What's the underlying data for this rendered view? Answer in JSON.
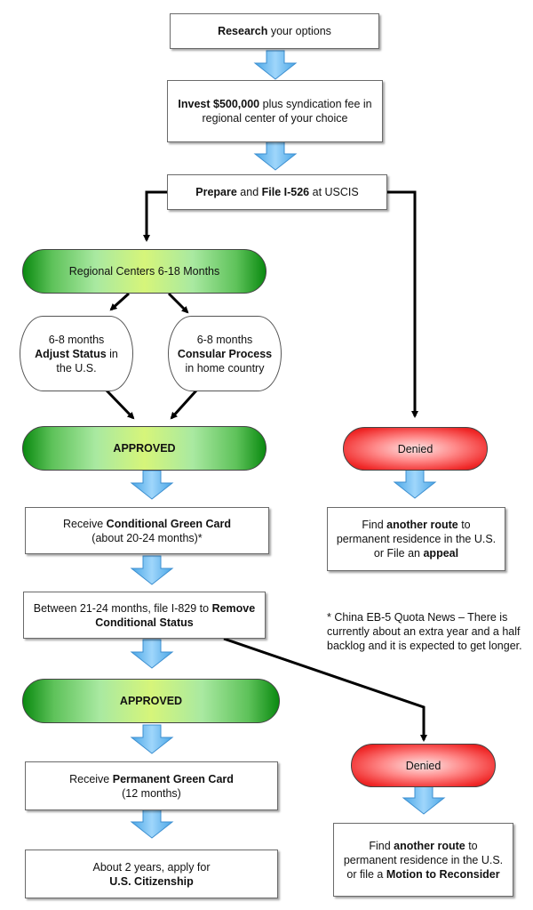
{
  "flowchart": {
    "research": {
      "bold": "Research",
      "rest": " your options"
    },
    "invest": {
      "bold": "Invest $500,000",
      "rest": " plus syndication fee in regional center of your choice"
    },
    "prepare": {
      "b1": "Prepare",
      "t1": " and ",
      "b2": "File I-526",
      "t2": " at USCIS"
    },
    "regional_centers": "Regional Centers 6-18 Months",
    "adjust": {
      "t1": "6-8 months",
      "b1": "Adjust Status",
      "t2": " in the U.S."
    },
    "consular": {
      "t1": "6-8 months",
      "b1": "Consular Process",
      "t2": " in home country"
    },
    "approved_1": "APPROVED",
    "denied_1": "Denied",
    "alt_route_1": {
      "t1": "Find ",
      "b1": "another route",
      "t2": " to permanent residence in the U.S. or File an ",
      "b2": "appeal"
    },
    "conditional_card": {
      "t1": "Receive ",
      "b1": "Conditional Green Card",
      "t2": "(about 20-24 months)*"
    },
    "remove_conditions": {
      "t1": "Between 21-24 months, file I-829 to ",
      "b1": "Remove Conditional Status"
    },
    "note": "* China EB-5 Quota News – There is currently about an extra year and a half backlog and it is expected to get longer.",
    "approved_2": "APPROVED",
    "permanent_card": {
      "t1": "Receive ",
      "b1": "Permanent Green Card",
      "t2": "(12 months)"
    },
    "citizenship": {
      "t1": "About 2 years, apply for",
      "b1": "U.S. Citizenship"
    },
    "denied_2": "Denied",
    "alt_route_2": {
      "t1": "Find ",
      "b1": "another route",
      "t2": " to permanent residence in the U.S. or file a ",
      "b2": "Motion to Reconsider"
    }
  },
  "colors": {
    "arrow_fill": "#6bbdf0",
    "approved": "#0a8a10",
    "denied": "#f02a2a"
  }
}
